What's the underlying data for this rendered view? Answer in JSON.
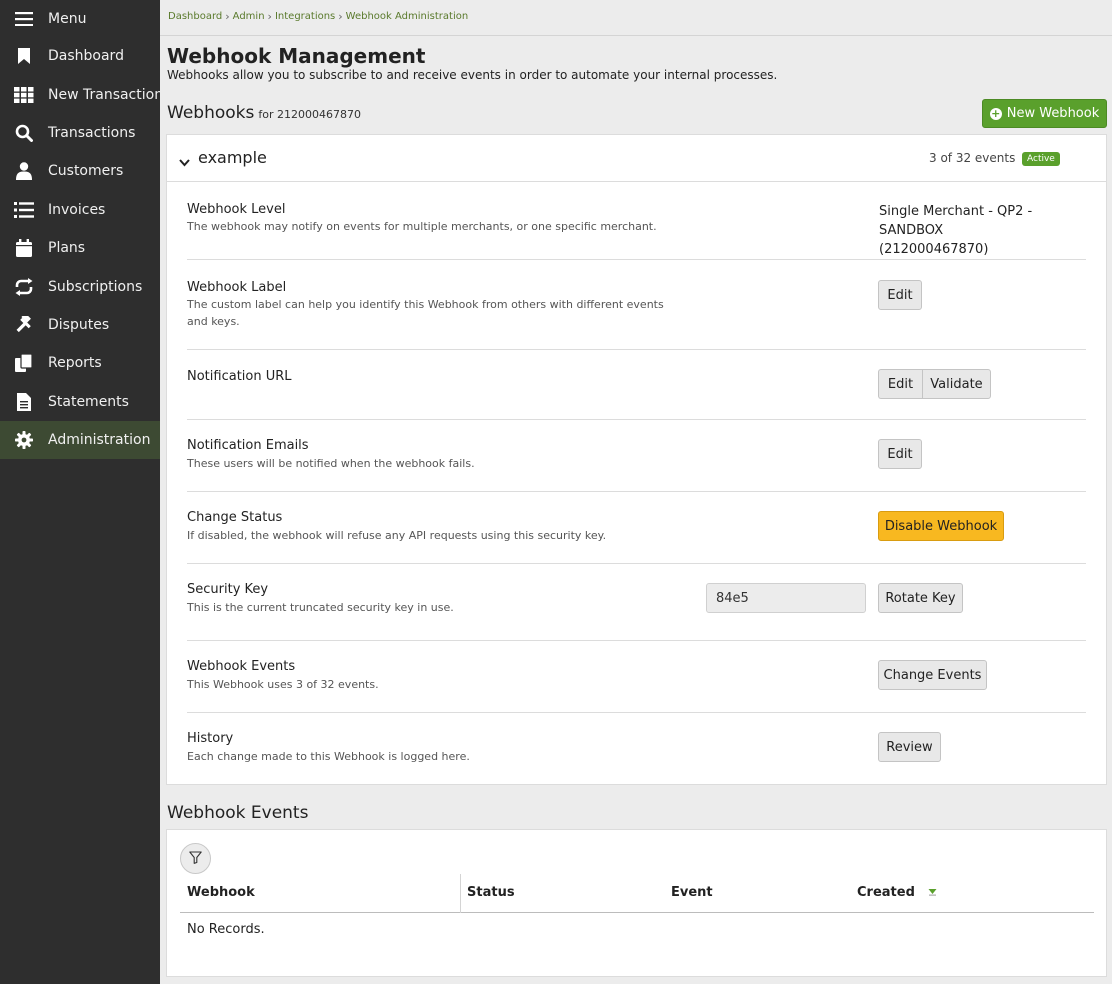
{
  "sidebar": {
    "menu_label": "Menu",
    "items": [
      {
        "label": "Dashboard",
        "icon": "bookmark-icon"
      },
      {
        "label": "New Transaction",
        "icon": "grid-icon"
      },
      {
        "label": "Transactions",
        "icon": "search-icon"
      },
      {
        "label": "Customers",
        "icon": "user-icon"
      },
      {
        "label": "Invoices",
        "icon": "list-icon"
      },
      {
        "label": "Plans",
        "icon": "calendar-icon"
      },
      {
        "label": "Subscriptions",
        "icon": "repeat-icon"
      },
      {
        "label": "Disputes",
        "icon": "gavel-icon"
      },
      {
        "label": "Reports",
        "icon": "copy-icon"
      },
      {
        "label": "Statements",
        "icon": "file-icon"
      },
      {
        "label": "Administration",
        "icon": "gear-icon",
        "active": true
      }
    ]
  },
  "breadcrumb": [
    "Dashboard",
    "Admin",
    "Integrations",
    "Webhook Administration"
  ],
  "page": {
    "title": "Webhook Management",
    "description": "Webhooks allow you to subscribe to and receive events in order to automate your internal processes."
  },
  "webhooks": {
    "title": "Webhooks",
    "subtitle": "for 212000467870",
    "new_button": "New Webhook"
  },
  "webhook": {
    "name": "example",
    "events_count": "3 of 32 events",
    "status_badge": "Active",
    "rows": {
      "level": {
        "title": "Webhook Level",
        "desc": "The webhook may notify on events for multiple merchants, or one specific merchant.",
        "value_line1": "Single Merchant - QP2 - SANDBOX",
        "value_line2": "(212000467870)"
      },
      "label": {
        "title": "Webhook Label",
        "desc": "The custom label can help you identify this Webhook from others with different events and keys.",
        "button": "Edit"
      },
      "url": {
        "title": "Notification URL",
        "edit_button": "Edit",
        "validate_button": "Validate"
      },
      "emails": {
        "title": "Notification Emails",
        "desc": "These users will be notified when the webhook fails.",
        "button": "Edit"
      },
      "status": {
        "title": "Change Status",
        "desc": "If disabled, the webhook will refuse any API requests using this security key.",
        "button": "Disable Webhook"
      },
      "key": {
        "title": "Security Key",
        "desc": "This is the current truncated security key in use.",
        "value": "84e5",
        "button": "Rotate Key"
      },
      "events": {
        "title": "Webhook Events",
        "desc": "This Webhook uses 3 of 32 events.",
        "button": "Change Events"
      },
      "history": {
        "title": "History",
        "desc": "Each change made to this Webhook is logged here.",
        "button": "Review"
      }
    }
  },
  "events_table": {
    "title": "Webhook Events",
    "columns": [
      "Webhook",
      "Status",
      "Event",
      "Created"
    ],
    "empty_text": "No Records."
  },
  "colors": {
    "sidebar_bg": "#2e2e2e",
    "accent_green": "#5aa02c",
    "warn_yellow": "#f8b820"
  }
}
